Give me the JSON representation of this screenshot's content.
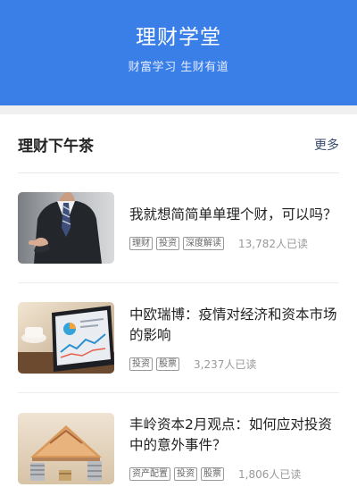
{
  "header": {
    "title": "理财学堂",
    "subtitle": "财富学习 生财有道",
    "bg_color": "#3a7ee8"
  },
  "section": {
    "title": "理财下午茶",
    "more_label": "更多"
  },
  "articles": [
    {
      "title": "我就想简简单单理个财，可以吗？",
      "tags": [
        "理财",
        "投资",
        "深度解读"
      ],
      "reads": "13,782人已读",
      "thumb": "businessman-pointing-image"
    },
    {
      "title": "中欧瑞博：疫情对经济和资本市场的影响",
      "tags": [
        "投资",
        "股票"
      ],
      "reads": "3,237人已读",
      "thumb": "tablet-chart-image"
    },
    {
      "title": "丰岭资本2月观点：如何应对投资中的意外事件？",
      "tags": [
        "资产配置",
        "投资",
        "股票"
      ],
      "reads": "1,806人已读",
      "thumb": "money-house-image"
    }
  ]
}
